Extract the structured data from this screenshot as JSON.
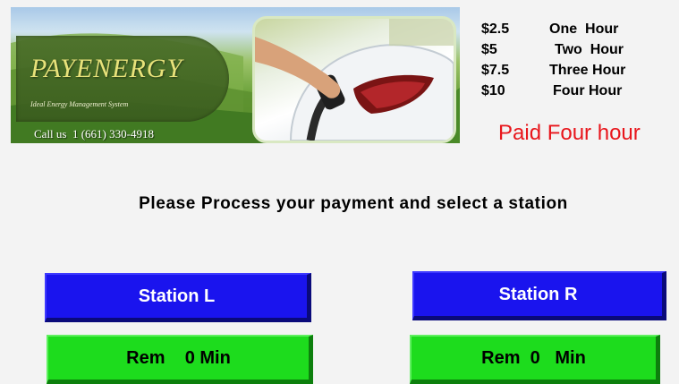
{
  "banner": {
    "brand": "PAYENERGY",
    "tagline": "Ideal Energy Management System",
    "phone": "Call us  1 (661) 330-4918"
  },
  "rates": [
    {
      "price": "$2.5",
      "label": "One  Hour"
    },
    {
      "price": "$5",
      "label": "Two  Hour"
    },
    {
      "price": "$7.5",
      "label": "Three Hour"
    },
    {
      "price": "$10",
      "label": "Four Hour"
    }
  ],
  "status": {
    "paid": "Paid Four hour",
    "paid_color": "#e8151b"
  },
  "prompt": "Please Process your payment and select a station",
  "stations": {
    "left": {
      "label": "Station L",
      "remaining": "Rem    0 Min"
    },
    "right": {
      "label": "Station R",
      "remaining": "Rem  0   Min"
    }
  },
  "colors": {
    "station_button": "#1a14ee",
    "remaining_button": "#1ddc1d"
  },
  "icons": [
    "ev-charging-photo"
  ]
}
